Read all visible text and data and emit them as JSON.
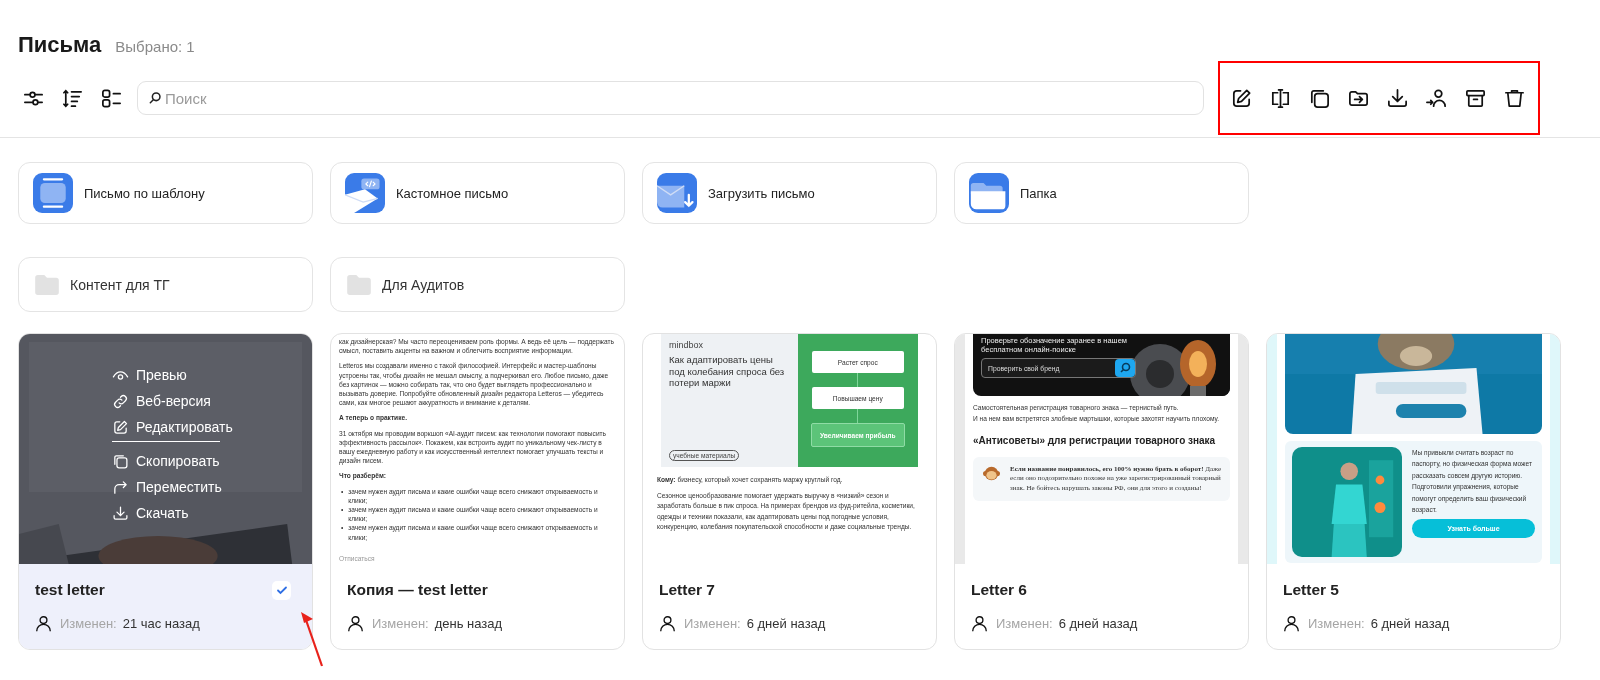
{
  "header": {
    "title": "Письма",
    "selection_count": "Выбрано: 1"
  },
  "search": {
    "placeholder": "Поиск"
  },
  "create_options": [
    {
      "kind": "template",
      "label": "Письмо по шаблону"
    },
    {
      "kind": "custom",
      "label": "Кастомное письмо"
    },
    {
      "kind": "upload",
      "label": "Загрузить письмо"
    },
    {
      "kind": "folder",
      "label": "Папка"
    }
  ],
  "folders": [
    {
      "name": "Контент для ТГ"
    },
    {
      "name": "Для Аудитов"
    }
  ],
  "letters": [
    {
      "title": "test letter",
      "selected": true,
      "modified_label": "Изменен:",
      "modified_time": "21 час назад",
      "preview": {
        "kind": "picture"
      },
      "menu_groups": [
        [
          {
            "kind": "preview",
            "label": "Превью"
          },
          {
            "kind": "web",
            "label": "Веб-версия"
          },
          {
            "kind": "edit",
            "label": "Редактировать"
          }
        ],
        [
          {
            "kind": "copy",
            "label": "Скопировать"
          },
          {
            "kind": "move",
            "label": "Переместить"
          },
          {
            "kind": "download",
            "label": "Скачать"
          }
        ]
      ]
    },
    {
      "title": "Копия — test letter",
      "selected": false,
      "modified_label": "Изменен:",
      "modified_time": "день назад",
      "preview": {
        "kind": "text",
        "blocks": [
          {
            "kind": "para",
            "text": "как дизайнерская? Мы часто переоцениваем роль формы. А ведь её цель — поддержать смысл, поставить акценты на важном и облегчить восприятие информации."
          },
          {
            "kind": "para",
            "text": "Letteros мы создавали именно с такой философией. Интерфейс и мастер-шаблоны устроены так, чтобы дизайн не мешал смыслу, а подчеркивал его. Любое письмо, даже без картинок — можно собирать так, что оно будет выглядеть профессионально и вызывать доверие. Попробуйте обновленный дизайн редактора Letteros — убедитесь сами, как многое решают аккуратность и внимание к деталям."
          },
          {
            "kind": "heading",
            "text": "А теперь о практике."
          },
          {
            "kind": "para",
            "text": "31 октября мы проводим воркшоп «AI-аудит писем: как технологии помогают повысить эффективность рассылок». Покажем, как встроить аудит по уникальному чек-листу в вашу ежедневную работу и как искусственный интеллект помогает улучшать тексты и дизайн писем."
          },
          {
            "kind": "heading",
            "text": "Что разберём:"
          },
          {
            "kind": "bullets",
            "marker": "•",
            "items": [
              "зачем нужен аудит письма и какие ошибки чаще всего снижают открываемость и клики;",
              "зачем нужен аудит письма и какие ошибки чаще всего снижают открываемость и клики;",
              "зачем нужен аудит письма и какие ошибки чаще всего снижают открываемость и клики;"
            ]
          },
          {
            "kind": "footer",
            "text": "Отписаться"
          }
        ]
      }
    },
    {
      "title": "Letter 7",
      "selected": false,
      "modified_label": "Изменен:",
      "modified_time": "6 дней назад",
      "preview": {
        "kind": "promo",
        "brand": "mindbox",
        "headline": "Как адаптировать цены под колебания спроса без потери маржи",
        "tag": "учебные материалы",
        "steps": [
          {
            "label": "Растет спрос",
            "highlighted": false
          },
          {
            "label": "Повышаем цену",
            "highlighted": false
          },
          {
            "label": "Увеличиваем прибыль",
            "highlighted": true
          }
        ],
        "paragraphs": [
          "**Кому:** бизнесу, который хочет сохранять маржу круглый год.",
          "Сезонное ценообразование помогает удержать выручку в «низкий» сезон и заработать больше в пик спроса. На примерах брендов из фуд-ритейла, косметики, одежды и техники показали, как адаптировать цены под погодные условия, конкуренцию, колебания покупательской способности и даже социальные тренды."
        ]
      }
    },
    {
      "title": "Letter 6",
      "selected": false,
      "modified_label": "Изменен:",
      "modified_time": "6 дней назад",
      "preview": {
        "kind": "search_banner",
        "banner_text": "Проверьте обозначение заранее в нашем бесплатном онлайн-поиске",
        "search_placeholder": "Проверить свой бренд",
        "lines": [
          "Самостоятельная регистрация товарного знака — тернистый путь.",
          "И на нем вам встретятся злобные мартышки, которые захотят научить плохому."
        ],
        "heading": "«Антисоветы» для регистрации товарного знака",
        "note": "**Если название понравилось, его 100% нужно брать в оборот!** Даже если оно подозрительно похоже на уже зарегистрированный товарный знак. Не бойтесь нарушать законы РФ, они для этого и созданы!"
      }
    },
    {
      "title": "Letter 5",
      "selected": false,
      "modified_label": "Изменен:",
      "modified_time": "6 дней назад",
      "preview": {
        "kind": "digest",
        "text": "Мы привыкли считать возраст по паспорту, но физическая форма может рассказать совсем другую историю. Подготовили упражнения, которые помогут определить ваш физический возраст.",
        "button": "Узнать больше"
      }
    }
  ]
}
